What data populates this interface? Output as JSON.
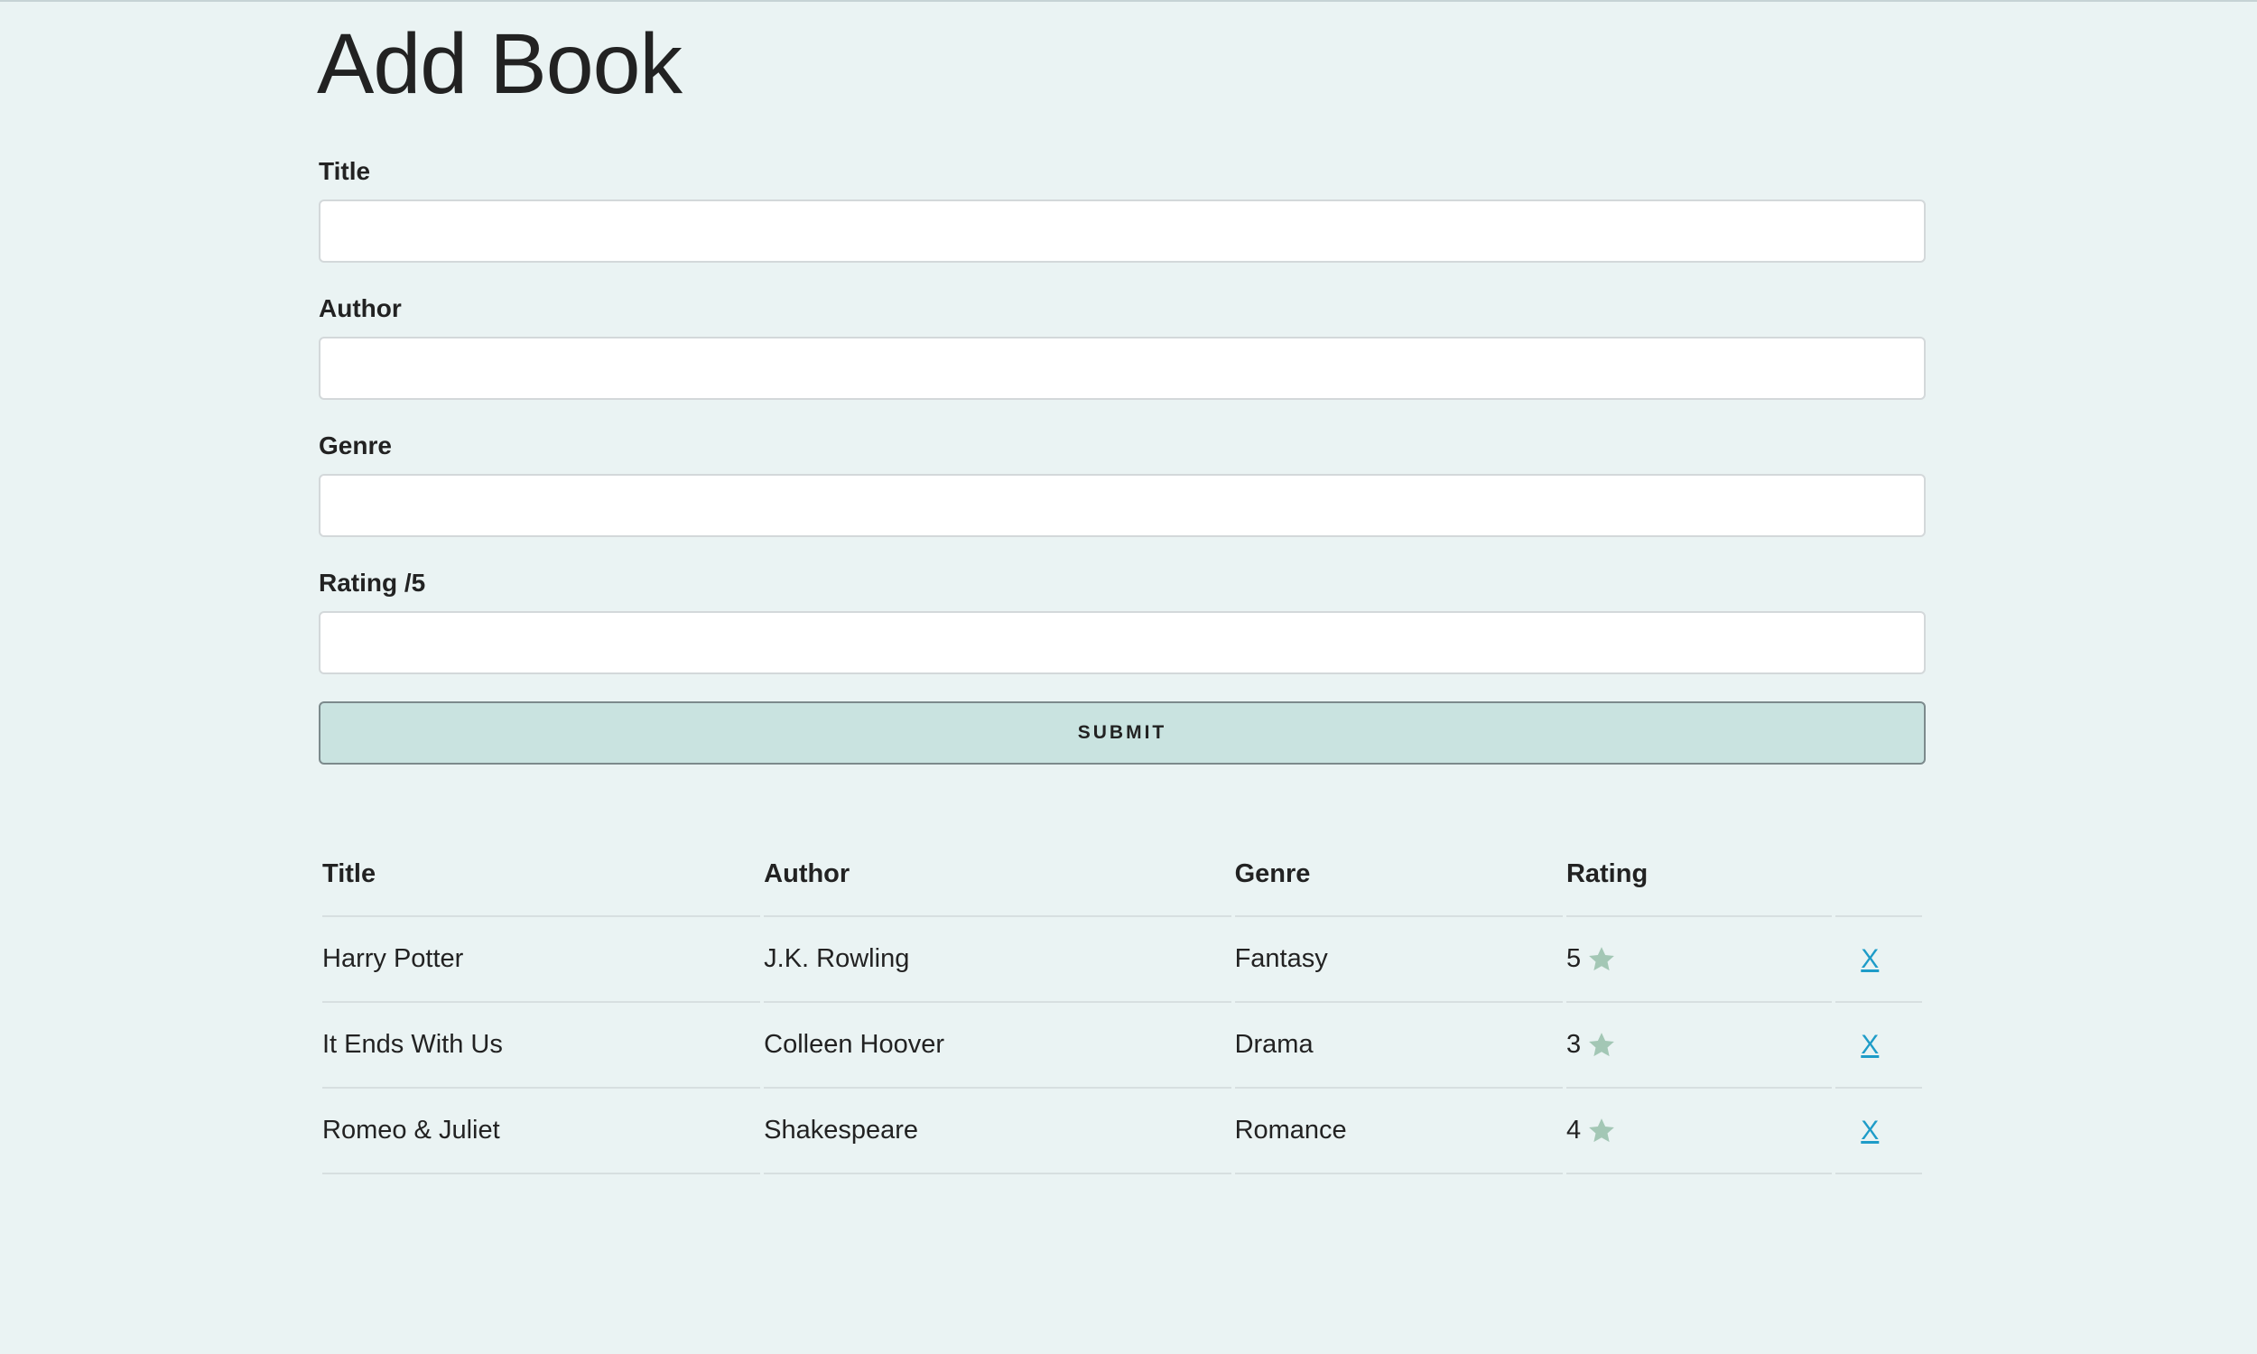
{
  "page": {
    "title": "Add Book"
  },
  "form": {
    "fields": [
      {
        "label": "Title",
        "value": "",
        "placeholder": ""
      },
      {
        "label": "Author",
        "value": "",
        "placeholder": ""
      },
      {
        "label": "Genre",
        "value": "",
        "placeholder": ""
      },
      {
        "label": "Rating /5",
        "value": "",
        "placeholder": ""
      }
    ],
    "submit_label": "SUBMIT"
  },
  "table": {
    "headers": [
      "Title",
      "Author",
      "Genre",
      "Rating",
      ""
    ],
    "rows": [
      {
        "title": "Harry Potter",
        "author": "J.K. Rowling",
        "genre": "Fantasy",
        "rating": "5",
        "delete_label": "X"
      },
      {
        "title": "It Ends With Us",
        "author": "Colleen Hoover",
        "genre": "Drama",
        "rating": "3",
        "delete_label": "X"
      },
      {
        "title": "Romeo & Juliet",
        "author": "Shakespeare",
        "genre": "Romance",
        "rating": "4",
        "delete_label": "X"
      }
    ]
  },
  "icons": {
    "rating": "star-icon"
  },
  "colors": {
    "background": "#eaf3f3",
    "button": "#c9e3e0",
    "star": "#a3c7b5",
    "link": "#1e9cc8"
  }
}
